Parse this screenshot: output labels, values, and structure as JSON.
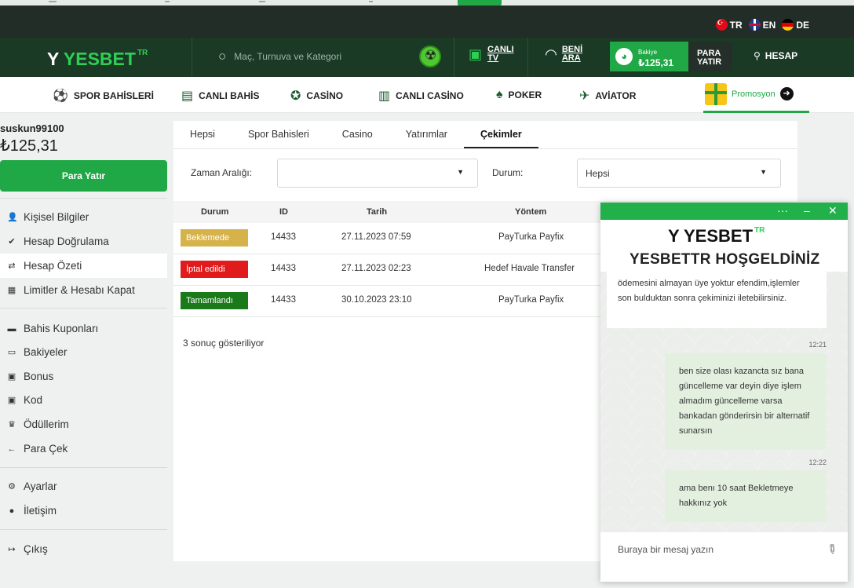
{
  "languages": [
    {
      "code": "TR"
    },
    {
      "code": "EN"
    },
    {
      "code": "DE"
    }
  ],
  "header": {
    "logo_main": "YESBET",
    "logo_sup": "TR",
    "search_placeholder": "Maç, Turnuva ve Kategori",
    "live_tv": [
      "CANLI",
      "TV"
    ],
    "call_me": [
      "BENİ",
      "ARA"
    ],
    "balance_label": "Bakiye",
    "balance_amount": "₺125,31",
    "deposit": [
      "PARA",
      "YATIR"
    ],
    "account": "HESAP"
  },
  "nav": {
    "items": [
      "SPOR BAHİSLERİ",
      "CANLI BAHİS",
      "CASİNO",
      "CANLI CASİNO",
      "POKER",
      "AVİATOR"
    ],
    "promo": "Promosyon"
  },
  "sidebar": {
    "username": "suskun99100",
    "balance": "₺125,31",
    "deposit_button": "Para Yatır",
    "items": [
      "Kişisel Bilgiler",
      "Hesap Doğrulama",
      "Hesap Özeti",
      "Limitler & Hesabı Kapat",
      "Bahis Kuponları",
      "Bakiyeler",
      "Bonus",
      "Kod",
      "Ödüllerim",
      "Para Çek",
      "Ayarlar",
      "İletişim",
      "Çıkış"
    ]
  },
  "main": {
    "tabs": [
      "Hepsi",
      "Spor Bahisleri",
      "Casino",
      "Yatırımlar",
      "Çekimler"
    ],
    "active_tab": "Çekimler",
    "date_range_label": "Zaman Aralığı:",
    "date_range_value": "",
    "status_label": "Durum:",
    "status_value": "Hepsi",
    "columns": [
      "Durum",
      "ID",
      "Tarih",
      "Yöntem"
    ],
    "rows": [
      {
        "status": "Beklemede",
        "color": "#d6b24a",
        "id": "14433",
        "date": "27.11.2023 07:59",
        "method": "PayTurka Payfix"
      },
      {
        "status": "İptal edildi",
        "color": "#e11b1b",
        "id": "14433",
        "date": "27.11.2023 02:23",
        "method": "Hedef Havale Transfer"
      },
      {
        "status": "Tamamlandı",
        "color": "#1a7a1a",
        "id": "14433",
        "date": "30.10.2023 23:10",
        "method": "PayTurka Payfix"
      }
    ],
    "result_text": "3 sonuç gösteriliyor"
  },
  "chat": {
    "logo_main": "YESBET",
    "logo_sup": "TR",
    "welcome": "YESBETTR HOŞGELDİNİZ",
    "messages": [
      {
        "from": "agent",
        "text": "ödemesini almayan üye yoktur efendim,işlemler son bulduktan sonra çekiminizi iletebilirsiniz.",
        "time": "12:21"
      },
      {
        "from": "user",
        "text": "ben size olası kazancta sız bana güncelleme var deyin diye işlem almadım güncelleme varsa bankadan gönderirsin bir alternatif sunarsın",
        "time": "12:22"
      },
      {
        "from": "user",
        "text": "ama benı 10 saat Bekletmeye hakkınız yok",
        "time": ""
      }
    ],
    "input_placeholder": "Buraya bir mesaj yazın"
  }
}
